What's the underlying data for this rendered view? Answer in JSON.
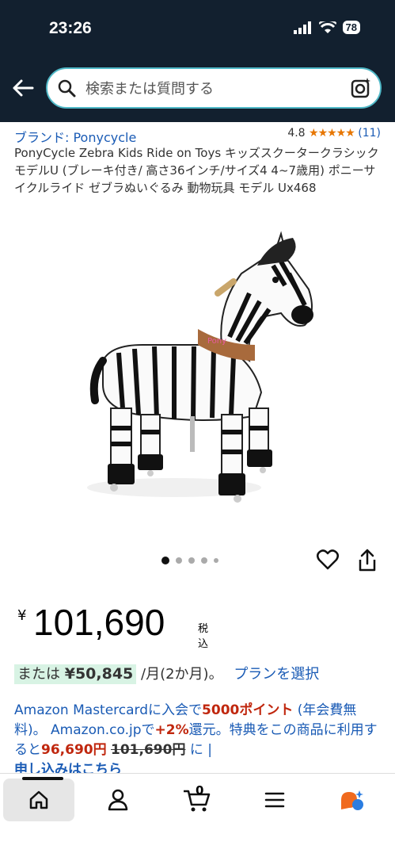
{
  "status": {
    "time": "23:26",
    "battery": "78"
  },
  "search": {
    "placeholder": "検索または質問する"
  },
  "product": {
    "brand": "ブランド: Ponycycle",
    "rating": "4.8",
    "stars": "★★★★★",
    "review_count": "(11)",
    "title": "PonyCycle Zebra Kids Ride on Toys キッズスクータークラシックモデルU (ブレーキ付き/ 高さ36インチ/サイズ4 4~7歳用) ポニーサイクルライド ゼブラぬいぐるみ 動物玩具 モデル Ux468",
    "image_count": 5,
    "image_index": 1
  },
  "price": {
    "symbol": "¥",
    "value": "101,690",
    "tax": "税込"
  },
  "installment": {
    "prefix": "または",
    "amount": "¥50,845",
    "suffix": "/月(2か月)。",
    "plan_link": "プランを選択"
  },
  "promo": {
    "part1": "Amazon Mastercardに入会で",
    "points": "5000ポイント",
    "part2": " (年会費無料)。 Amazon.co.jpで",
    "percent": "+2%",
    "part3": "還元。特典をこの商品に利用すると",
    "new_price": "96,690円",
    "old_price": "101,690円",
    "part4": " に |",
    "apply_link": "申し込みはこちら"
  },
  "nav": {
    "cart_count": "0"
  }
}
